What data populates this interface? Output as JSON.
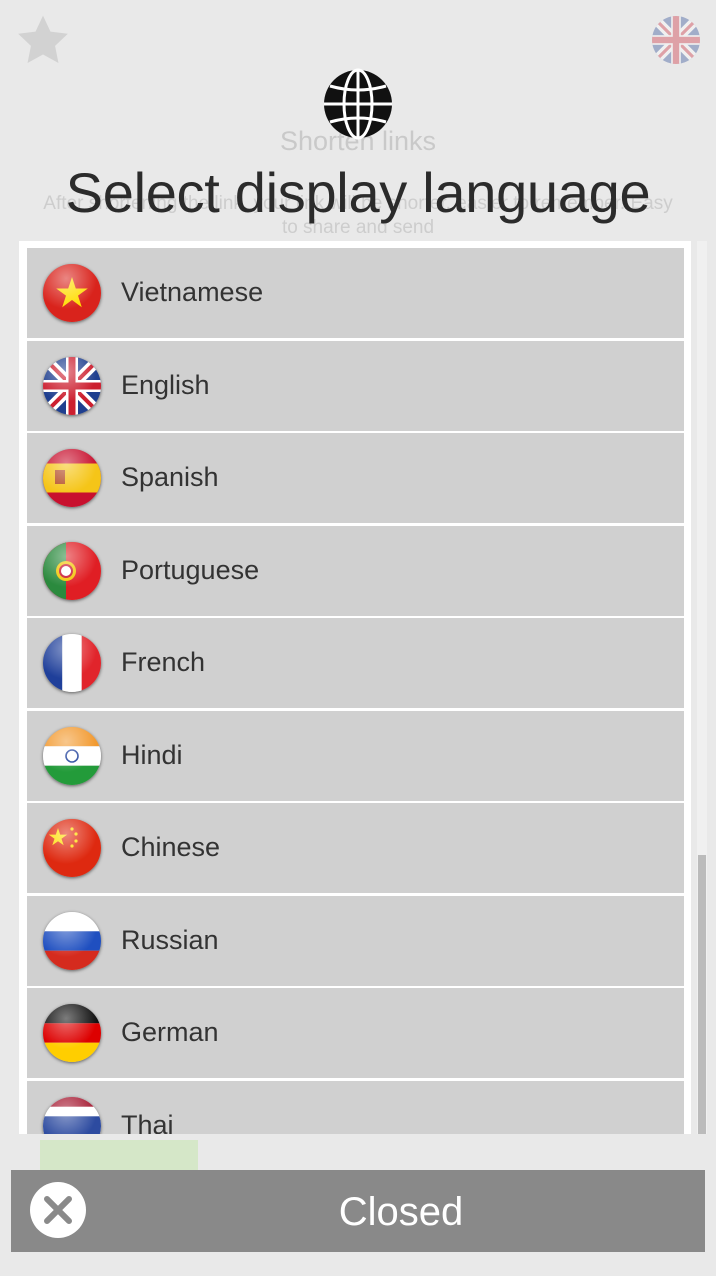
{
  "background": {
    "title": "Shorten links",
    "description": "After shortening the link, your link will be shorter, easier to remember. Easy to share and send"
  },
  "dialog": {
    "title": "Select display language",
    "languages": [
      {
        "label": "Vietnamese",
        "flag": "vietnam-flag-icon"
      },
      {
        "label": "English",
        "flag": "uk-flag-icon"
      },
      {
        "label": "Spanish",
        "flag": "spain-flag-icon"
      },
      {
        "label": "Portuguese",
        "flag": "portugal-flag-icon"
      },
      {
        "label": "French",
        "flag": "france-flag-icon"
      },
      {
        "label": "Hindi",
        "flag": "india-flag-icon"
      },
      {
        "label": "Chinese",
        "flag": "china-flag-icon"
      },
      {
        "label": "Russian",
        "flag": "russia-flag-icon"
      },
      {
        "label": "German",
        "flag": "germany-flag-icon"
      },
      {
        "label": "Thai",
        "flag": "thailand-flag-icon"
      }
    ],
    "close_label": "Closed"
  },
  "colors": {
    "row_bg": "#d0d0d0",
    "close_bar_bg": "#898989",
    "title_text": "#2b2b2b"
  }
}
